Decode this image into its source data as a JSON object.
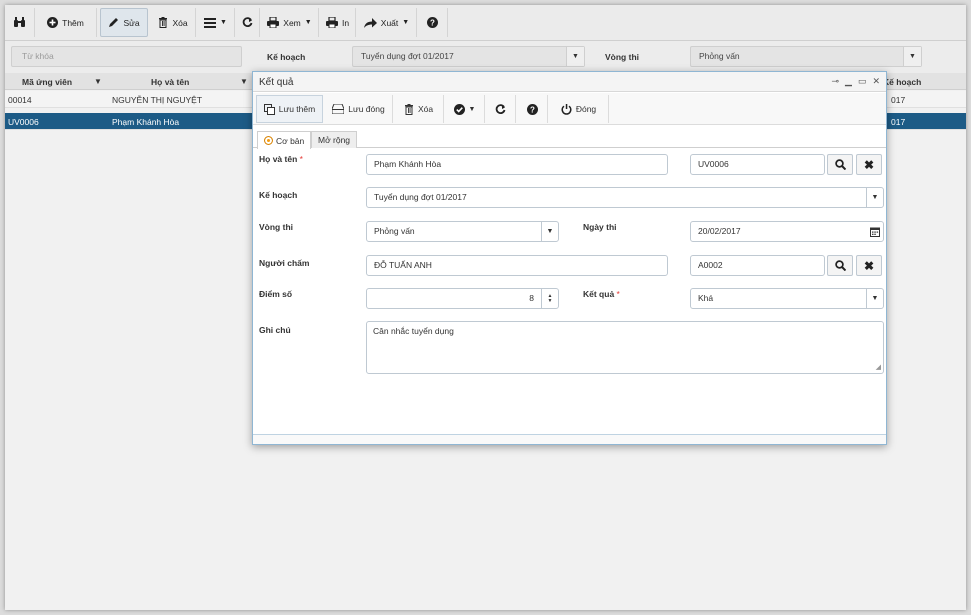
{
  "toolbar": {
    "add": "Thêm",
    "edit": "Sửa",
    "delete": "Xóa",
    "view": "Xem",
    "print": "In",
    "export": "Xuất"
  },
  "filter": {
    "keyword_placeholder": "Từ khóa",
    "plan_label": "Kế hoạch",
    "plan_value": "Tuyển dụng đợt 01/2017",
    "round_label": "Vòng thi",
    "round_value": "Phỏng vấn"
  },
  "grid": {
    "columns": [
      "Mã ứng viên",
      "Họ và tên",
      "Kế hoạch"
    ],
    "rows": [
      {
        "code": "00014",
        "name": "NGUYỄN THỊ NGUYỆT",
        "plan": "017",
        "selected": false
      },
      {
        "code": "UV0006",
        "name": "Phạm Khánh Hòa",
        "plan": "017",
        "selected": true
      }
    ]
  },
  "dialog": {
    "title": "Kết quả",
    "toolbar": {
      "save_add": "Lưu thêm",
      "save_close": "Lưu đóng",
      "delete": "Xóa",
      "close": "Đóng"
    },
    "tabs": [
      "Cơ bản",
      "Mở rộng"
    ],
    "form": {
      "name_label": "Họ và tên",
      "name_value": "Phạm Khánh Hòa",
      "name_code": "UV0006",
      "plan_label": "Kế hoạch",
      "plan_value": "Tuyển dụng đợt 01/2017",
      "round_label": "Vòng thi",
      "round_value": "Phỏng vấn",
      "date_label": "Ngày thi",
      "date_value": "20/02/2017",
      "grader_label": "Người chấm",
      "grader_value": "ĐỖ TUẤN ANH",
      "grader_code": "A0002",
      "score_label": "Điểm số",
      "score_value": "8",
      "result_label": "Kết quả",
      "result_value": "Khá",
      "note_label": "Ghi chú",
      "note_value": "Cân nhắc tuyển dụng"
    },
    "required_mark": "*"
  },
  "colors": {
    "selected_row": "#1d5b86",
    "required": "#e53935",
    "tab_radio": "#f39c12"
  }
}
